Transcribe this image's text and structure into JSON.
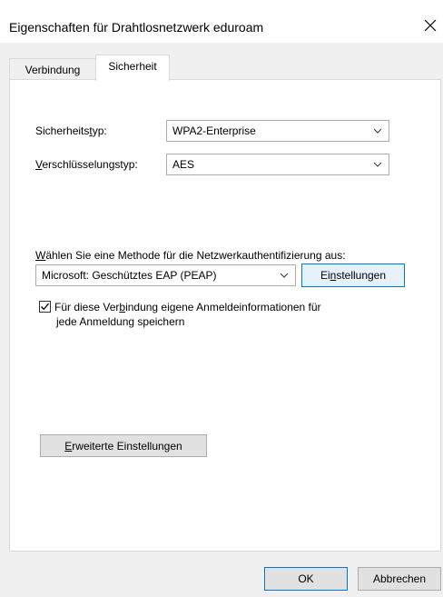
{
  "window": {
    "title": "Eigenschaften für Drahtlosnetzwerk eduroam",
    "close_icon": "close-icon"
  },
  "tabs": [
    {
      "label": "Verbindung",
      "selected": false
    },
    {
      "label": "Sicherheit",
      "selected": true
    }
  ],
  "security": {
    "type_label_pre": "Sicherheits",
    "type_label_u": "t",
    "type_label_post": "yp:",
    "type_value": "WPA2-Enterprise",
    "enc_label_u": "V",
    "enc_label_post": "erschlüsselungstyp:",
    "enc_value": "AES"
  },
  "auth": {
    "method_label_u": "W",
    "method_label_post": "ählen Sie eine Methode für die Netzwerkauthentifizierung aus:",
    "method_value": "Microsoft: Geschütztes EAP (PEAP)",
    "settings_pre": "Ei",
    "settings_u": "n",
    "settings_post": "stellungen",
    "remember_pre": "Für diese Ver",
    "remember_u": "b",
    "remember_post": "indung eigene Anmeldeinformationen für",
    "remember_line2": "jede Anmeldung speichern",
    "remember_checked": true
  },
  "advanced": {
    "label_u": "E",
    "label_post": "rweiterte Einstellungen"
  },
  "footer": {
    "ok_label": "OK",
    "cancel_label": "Abbrechen"
  },
  "colors": {
    "focus_border": "#0078d7",
    "button_face": "#e1e1e1",
    "dialog_bg": "#f0f0f0"
  }
}
